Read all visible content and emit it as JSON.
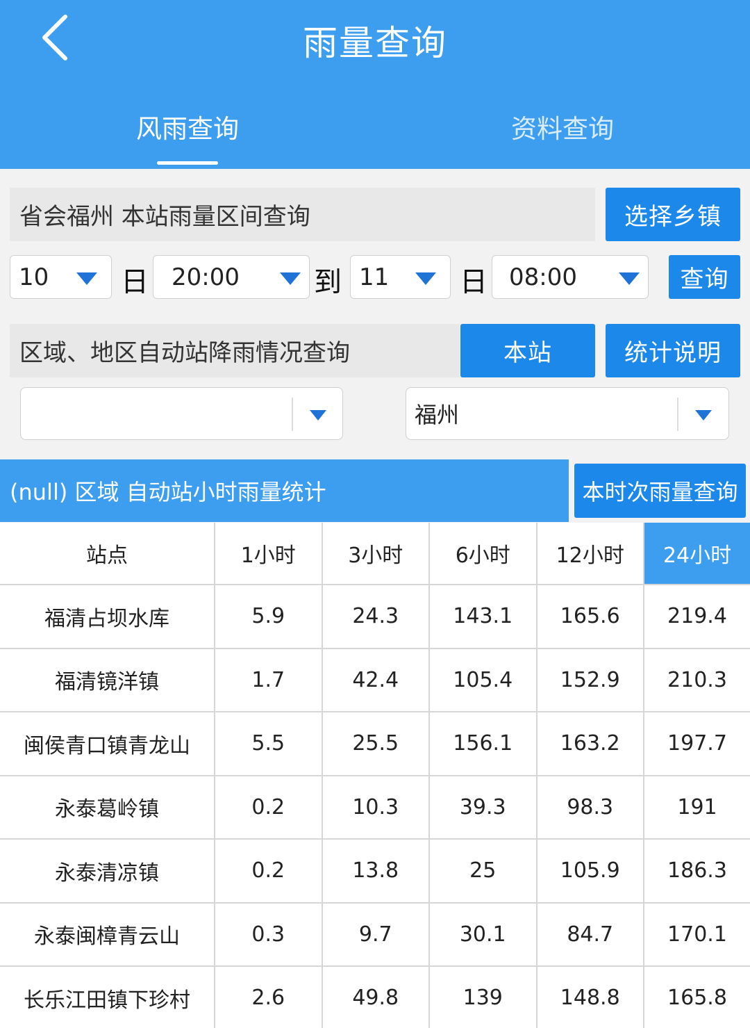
{
  "header": {
    "title": "雨量查询"
  },
  "tabs": [
    {
      "label": "风雨查询",
      "active": true
    },
    {
      "label": "资料查询",
      "active": false
    }
  ],
  "section1": {
    "label": "省会福州  本站雨量区间查询",
    "button": "选择乡镇"
  },
  "range": {
    "from_day": "10",
    "day_unit": "日",
    "from_time": "20:00",
    "to_label": "到",
    "to_day": "11",
    "to_time": "08:00",
    "query_button": "查询"
  },
  "section2": {
    "label": "区域、地区自动站降雨情况查询",
    "btn_station": "本站",
    "btn_stats": "统计说明"
  },
  "filters": {
    "region_value": "",
    "city_value": "福州"
  },
  "stat": {
    "label": "(null) 区域 自动站小时雨量统计",
    "button": "本时次雨量查询"
  },
  "table": {
    "headers": [
      "站点",
      "1小时",
      "3小时",
      "6小时",
      "12小时",
      "24小时"
    ],
    "active_column": 5,
    "rows": [
      [
        "福清占坝水库",
        "5.9",
        "24.3",
        "143.1",
        "165.6",
        "219.4"
      ],
      [
        "福清镜洋镇",
        "1.7",
        "42.4",
        "105.4",
        "152.9",
        "210.3"
      ],
      [
        "闽侯青口镇青龙山",
        "5.5",
        "25.5",
        "156.1",
        "163.2",
        "197.7"
      ],
      [
        "永泰葛岭镇",
        "0.2",
        "10.3",
        "39.3",
        "98.3",
        "191"
      ],
      [
        "永泰清凉镇",
        "0.2",
        "13.8",
        "25",
        "105.9",
        "186.3"
      ],
      [
        "永泰闽樟青云山",
        "0.3",
        "9.7",
        "30.1",
        "84.7",
        "170.1"
      ],
      [
        "长乐江田镇下珍村",
        "2.6",
        "49.8",
        "139",
        "148.8",
        "165.8"
      ]
    ]
  },
  "colors": {
    "header_blue": "#3d9ef0",
    "button_blue": "#1c88ea",
    "arrow_blue": "#1f73d6"
  },
  "icons": {
    "back": "chevron-left-icon",
    "dropdown": "triangle-down-icon"
  }
}
